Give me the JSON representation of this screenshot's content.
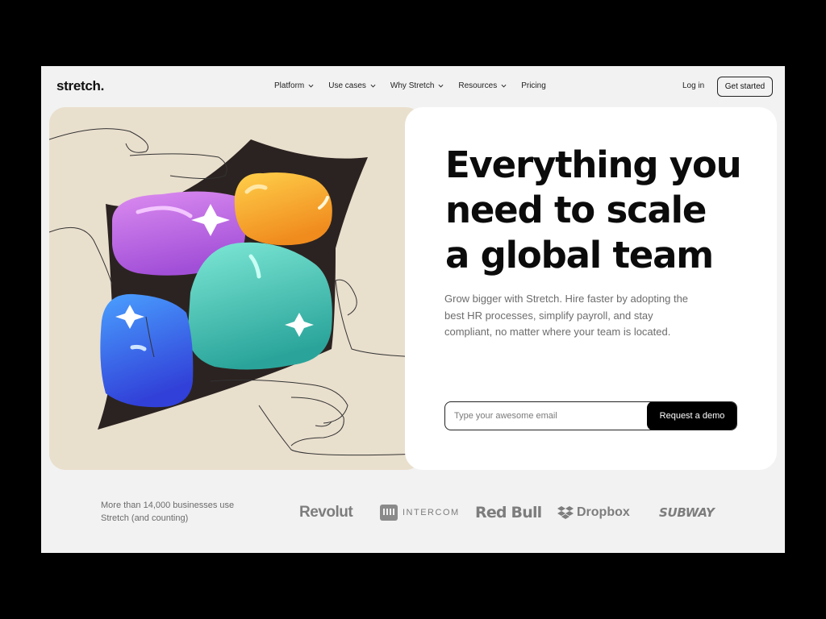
{
  "brand": {
    "logo": "stretch."
  },
  "nav": {
    "items": [
      {
        "label": "Platform",
        "dropdown": true
      },
      {
        "label": "Use cases",
        "dropdown": true
      },
      {
        "label": "Why Stretch",
        "dropdown": true
      },
      {
        "label": "Resources",
        "dropdown": true
      },
      {
        "label": "Pricing",
        "dropdown": false
      }
    ],
    "login": "Log in",
    "cta": "Get started"
  },
  "hero": {
    "title_lines": [
      "Everything you",
      "need to scale",
      "a global team"
    ],
    "subtitle": "Grow bigger with Stretch. Hire faster by adopting the best HR processes, simplify payroll, and stay compliant, no matter where your team is located.",
    "email_placeholder": "Type your awesome email",
    "email_value": "",
    "demo_button": "Request a demo"
  },
  "trust": {
    "text": "More than 14,000 businesses use Stretch (and counting)",
    "logos": [
      "Revolut",
      "INTERCOM",
      "Red Bull",
      "Dropbox",
      "SUBWAY"
    ]
  },
  "colors": {
    "page_bg": "#f2f2f2",
    "illustration_bg": "#e9dfcd",
    "accent_dark": "#000000",
    "blob_purple": "#c77ae6",
    "blob_orange": "#f6a92e",
    "blob_teal": "#5fd3c0",
    "blob_blue": "#3a6bf0"
  }
}
